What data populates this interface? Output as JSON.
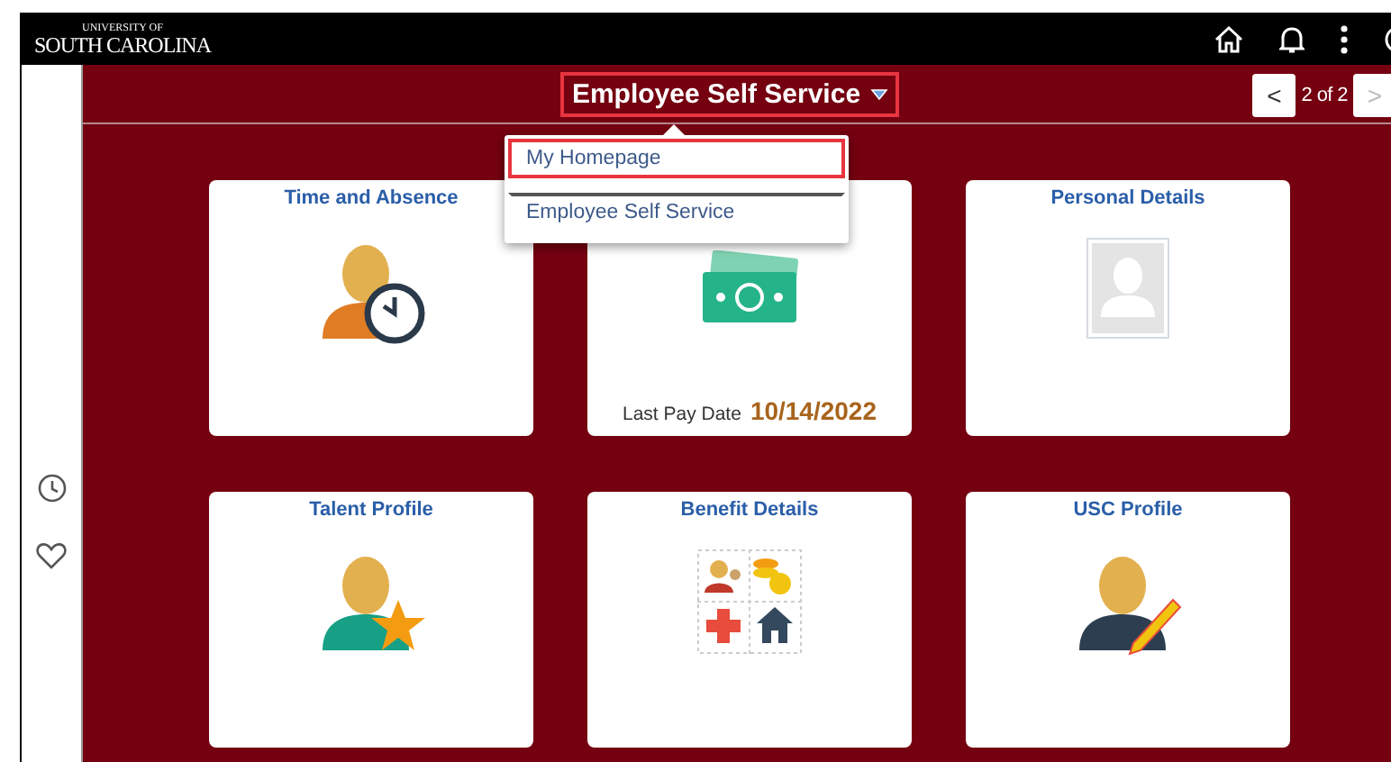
{
  "top_bar": {
    "logo_line1": "UNIVERSITY OF",
    "logo_line2": "SOUTH CAROLINA"
  },
  "header": {
    "title": "Employee Self Service",
    "pager": {
      "prev": "<",
      "text": "2 of 2",
      "next": ">",
      "prev_disabled": false,
      "next_disabled": true
    }
  },
  "dropdown": {
    "items": [
      {
        "label": "My Homepage",
        "selected": true
      },
      {
        "label": "Employee Self Service",
        "selected": false
      }
    ]
  },
  "tiles": [
    {
      "kind": "time",
      "title": "Time and Absence"
    },
    {
      "kind": "pay",
      "footer_label": "Last Pay Date",
      "footer_value": "10/14/2022"
    },
    {
      "kind": "personal",
      "title": "Personal Details"
    },
    {
      "kind": "talent",
      "title": "Talent Profile"
    },
    {
      "kind": "benefit",
      "title": "Benefit Details"
    },
    {
      "kind": "usc",
      "title": "USC Profile"
    }
  ]
}
